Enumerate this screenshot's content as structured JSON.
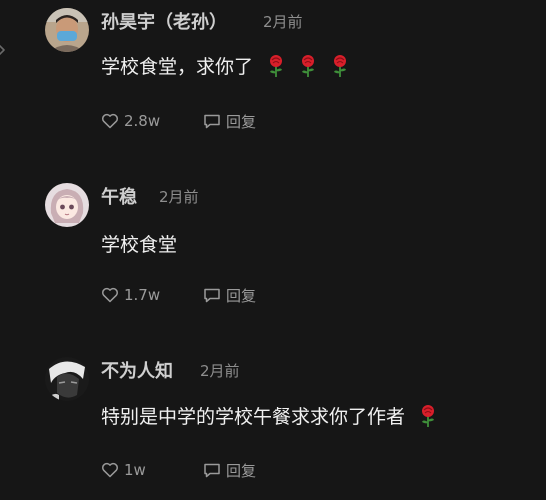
{
  "comments": [
    {
      "author": "孙昊宇（老孙）",
      "time": "2月前",
      "text": "学校食堂，求你了",
      "roses": 3,
      "likes": "2.8w",
      "reply_label": "回复"
    },
    {
      "author": "午稳",
      "time": "2月前",
      "text": "学校食堂",
      "roses": 0,
      "likes": "1.7w",
      "reply_label": "回复"
    },
    {
      "author": "不为人知",
      "time": "2月前",
      "text": "特别是中学的学校午餐求求你了作者",
      "roses": 1,
      "likes": "1w",
      "reply_label": "回复"
    }
  ],
  "icons": {
    "like": "heart-icon",
    "reply": "comment-icon",
    "emoji": "rose-emoji",
    "edge": "chevron-right-icon"
  },
  "colors": {
    "background": "#161616",
    "text": "#f0f0f0",
    "author": "#cfcfcf",
    "muted": "#8e8e8e",
    "rose": "#d81f2a"
  }
}
